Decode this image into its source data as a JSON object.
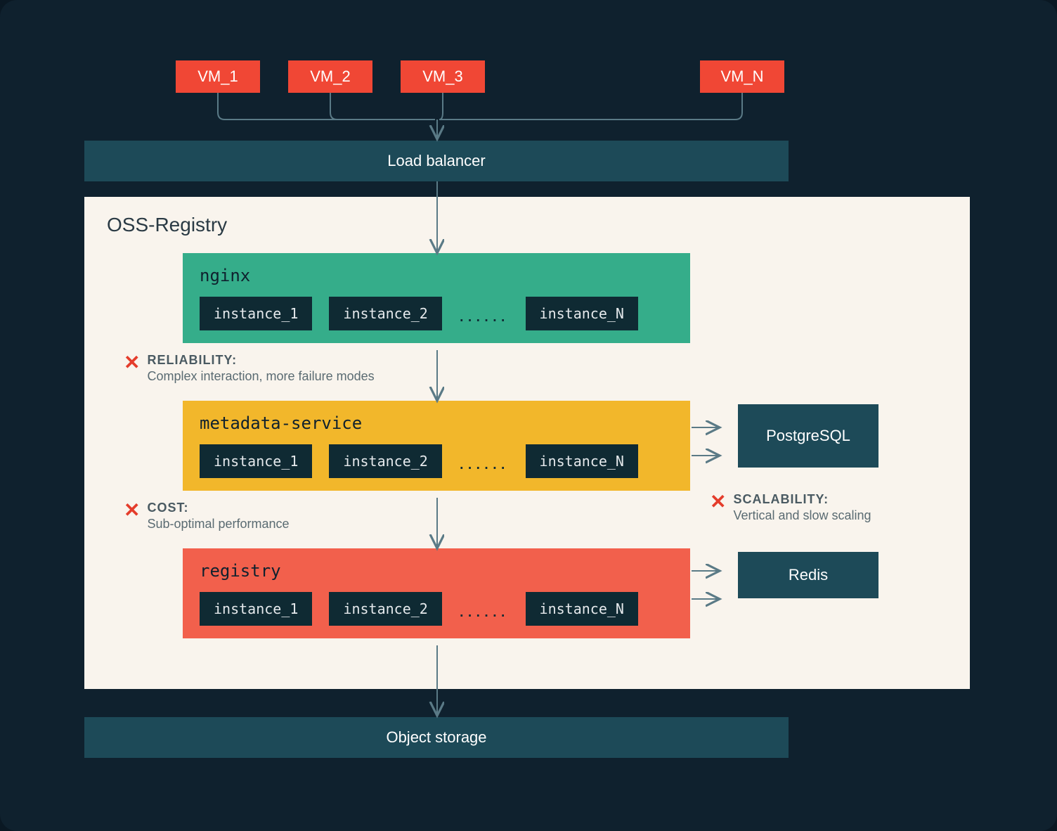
{
  "vms": {
    "vm1": "VM_1",
    "vm2": "VM_2",
    "vm3": "VM_3",
    "vmN": "VM_N"
  },
  "load_balancer": "Load balancer",
  "registry_title": "OSS-Registry",
  "nginx": {
    "title": "nginx",
    "inst1": "instance_1",
    "inst2": "instance_2",
    "dots": "......",
    "instN": "instance_N"
  },
  "metadata": {
    "title": "metadata-service",
    "inst1": "instance_1",
    "inst2": "instance_2",
    "dots": "......",
    "instN": "instance_N"
  },
  "registry": {
    "title": "registry",
    "inst1": "instance_1",
    "inst2": "instance_2",
    "dots": "......",
    "instN": "instance_N"
  },
  "db": {
    "postgres": "PostgreSQL",
    "redis": "Redis"
  },
  "storage": "Object storage",
  "issues": {
    "reliability": {
      "label": "RELIABILITY:",
      "text": "Complex interaction, more failure modes"
    },
    "cost": {
      "label": "COST:",
      "text": "Sub-optimal performance"
    },
    "scalability": {
      "label": "SCALABILITY:",
      "text": "Vertical and slow scaling"
    }
  },
  "colors": {
    "bg": "#0f212e",
    "red": "#f04735",
    "teal": "#1d4a58",
    "panel": "#f9f4ed",
    "green": "#35ad8a",
    "yellow": "#f2b72b",
    "coral": "#f2604c",
    "dark": "#0f2a33"
  }
}
